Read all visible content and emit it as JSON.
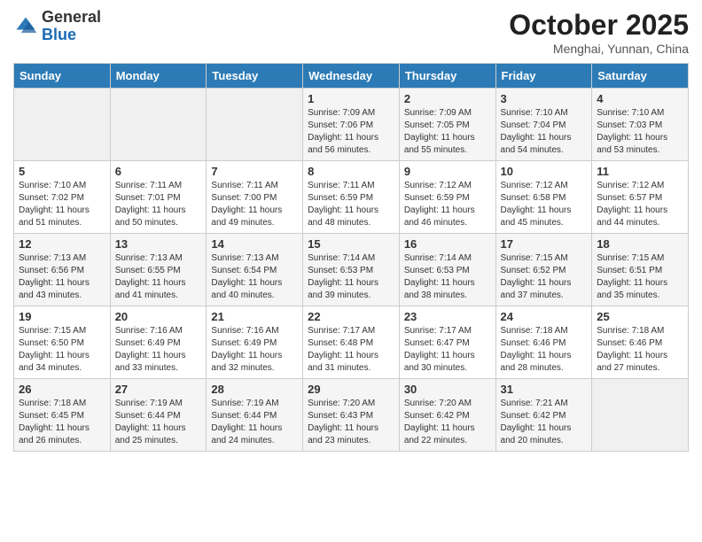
{
  "header": {
    "logo": {
      "general": "General",
      "blue": "Blue"
    },
    "title": "October 2025",
    "location": "Menghai, Yunnan, China"
  },
  "weekdays": [
    "Sunday",
    "Monday",
    "Tuesday",
    "Wednesday",
    "Thursday",
    "Friday",
    "Saturday"
  ],
  "weeks": [
    [
      {
        "day": "",
        "info": ""
      },
      {
        "day": "",
        "info": ""
      },
      {
        "day": "",
        "info": ""
      },
      {
        "day": "1",
        "info": "Sunrise: 7:09 AM\nSunset: 7:06 PM\nDaylight: 11 hours and 56 minutes."
      },
      {
        "day": "2",
        "info": "Sunrise: 7:09 AM\nSunset: 7:05 PM\nDaylight: 11 hours and 55 minutes."
      },
      {
        "day": "3",
        "info": "Sunrise: 7:10 AM\nSunset: 7:04 PM\nDaylight: 11 hours and 54 minutes."
      },
      {
        "day": "4",
        "info": "Sunrise: 7:10 AM\nSunset: 7:03 PM\nDaylight: 11 hours and 53 minutes."
      }
    ],
    [
      {
        "day": "5",
        "info": "Sunrise: 7:10 AM\nSunset: 7:02 PM\nDaylight: 11 hours and 51 minutes."
      },
      {
        "day": "6",
        "info": "Sunrise: 7:11 AM\nSunset: 7:01 PM\nDaylight: 11 hours and 50 minutes."
      },
      {
        "day": "7",
        "info": "Sunrise: 7:11 AM\nSunset: 7:00 PM\nDaylight: 11 hours and 49 minutes."
      },
      {
        "day": "8",
        "info": "Sunrise: 7:11 AM\nSunset: 6:59 PM\nDaylight: 11 hours and 48 minutes."
      },
      {
        "day": "9",
        "info": "Sunrise: 7:12 AM\nSunset: 6:59 PM\nDaylight: 11 hours and 46 minutes."
      },
      {
        "day": "10",
        "info": "Sunrise: 7:12 AM\nSunset: 6:58 PM\nDaylight: 11 hours and 45 minutes."
      },
      {
        "day": "11",
        "info": "Sunrise: 7:12 AM\nSunset: 6:57 PM\nDaylight: 11 hours and 44 minutes."
      }
    ],
    [
      {
        "day": "12",
        "info": "Sunrise: 7:13 AM\nSunset: 6:56 PM\nDaylight: 11 hours and 43 minutes."
      },
      {
        "day": "13",
        "info": "Sunrise: 7:13 AM\nSunset: 6:55 PM\nDaylight: 11 hours and 41 minutes."
      },
      {
        "day": "14",
        "info": "Sunrise: 7:13 AM\nSunset: 6:54 PM\nDaylight: 11 hours and 40 minutes."
      },
      {
        "day": "15",
        "info": "Sunrise: 7:14 AM\nSunset: 6:53 PM\nDaylight: 11 hours and 39 minutes."
      },
      {
        "day": "16",
        "info": "Sunrise: 7:14 AM\nSunset: 6:53 PM\nDaylight: 11 hours and 38 minutes."
      },
      {
        "day": "17",
        "info": "Sunrise: 7:15 AM\nSunset: 6:52 PM\nDaylight: 11 hours and 37 minutes."
      },
      {
        "day": "18",
        "info": "Sunrise: 7:15 AM\nSunset: 6:51 PM\nDaylight: 11 hours and 35 minutes."
      }
    ],
    [
      {
        "day": "19",
        "info": "Sunrise: 7:15 AM\nSunset: 6:50 PM\nDaylight: 11 hours and 34 minutes."
      },
      {
        "day": "20",
        "info": "Sunrise: 7:16 AM\nSunset: 6:49 PM\nDaylight: 11 hours and 33 minutes."
      },
      {
        "day": "21",
        "info": "Sunrise: 7:16 AM\nSunset: 6:49 PM\nDaylight: 11 hours and 32 minutes."
      },
      {
        "day": "22",
        "info": "Sunrise: 7:17 AM\nSunset: 6:48 PM\nDaylight: 11 hours and 31 minutes."
      },
      {
        "day": "23",
        "info": "Sunrise: 7:17 AM\nSunset: 6:47 PM\nDaylight: 11 hours and 30 minutes."
      },
      {
        "day": "24",
        "info": "Sunrise: 7:18 AM\nSunset: 6:46 PM\nDaylight: 11 hours and 28 minutes."
      },
      {
        "day": "25",
        "info": "Sunrise: 7:18 AM\nSunset: 6:46 PM\nDaylight: 11 hours and 27 minutes."
      }
    ],
    [
      {
        "day": "26",
        "info": "Sunrise: 7:18 AM\nSunset: 6:45 PM\nDaylight: 11 hours and 26 minutes."
      },
      {
        "day": "27",
        "info": "Sunrise: 7:19 AM\nSunset: 6:44 PM\nDaylight: 11 hours and 25 minutes."
      },
      {
        "day": "28",
        "info": "Sunrise: 7:19 AM\nSunset: 6:44 PM\nDaylight: 11 hours and 24 minutes."
      },
      {
        "day": "29",
        "info": "Sunrise: 7:20 AM\nSunset: 6:43 PM\nDaylight: 11 hours and 23 minutes."
      },
      {
        "day": "30",
        "info": "Sunrise: 7:20 AM\nSunset: 6:42 PM\nDaylight: 11 hours and 22 minutes."
      },
      {
        "day": "31",
        "info": "Sunrise: 7:21 AM\nSunset: 6:42 PM\nDaylight: 11 hours and 20 minutes."
      },
      {
        "day": "",
        "info": ""
      }
    ]
  ]
}
